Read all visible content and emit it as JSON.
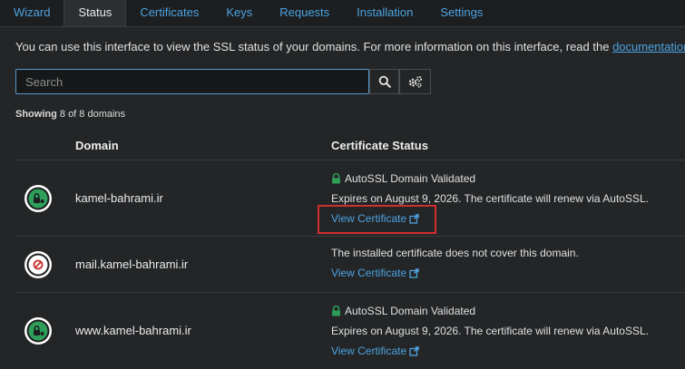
{
  "tabs": [
    "Wizard",
    "Status",
    "Certificates",
    "Keys",
    "Requests",
    "Installation",
    "Settings"
  ],
  "active_tab": "Status",
  "intro": {
    "text": "You can use this interface to view the SSL status of your domains. For more information on this interface, read the ",
    "link": "documentation",
    "end": "."
  },
  "search": {
    "placeholder": "Search",
    "value": ""
  },
  "showing": {
    "label": "Showing",
    "text": "8 of 8 domains"
  },
  "table": {
    "col_domain": "Domain",
    "col_status": "Certificate Status"
  },
  "rows": [
    {
      "domain": "kamel-bahrami.ir",
      "status": "valid",
      "title": "AutoSSL Domain Validated",
      "detail": "Expires on August 9, 2026. The certificate will renew via AutoSSL.",
      "link": "View Certificate"
    },
    {
      "domain": "mail.kamel-bahrami.ir",
      "status": "invalid",
      "detail": "The installed certificate does not cover this domain.",
      "link": "View Certificate"
    },
    {
      "domain": "www.kamel-bahrami.ir",
      "status": "valid",
      "title": "AutoSSL Domain Validated",
      "detail": "Expires on August 9, 2026. The certificate will renew via AutoSSL.",
      "link": "View Certificate"
    }
  ],
  "colors": {
    "accent": "#4da3e0",
    "valid": "#2e9e5b",
    "invalid": "#c9302c",
    "highlight": "#d12e2e"
  }
}
